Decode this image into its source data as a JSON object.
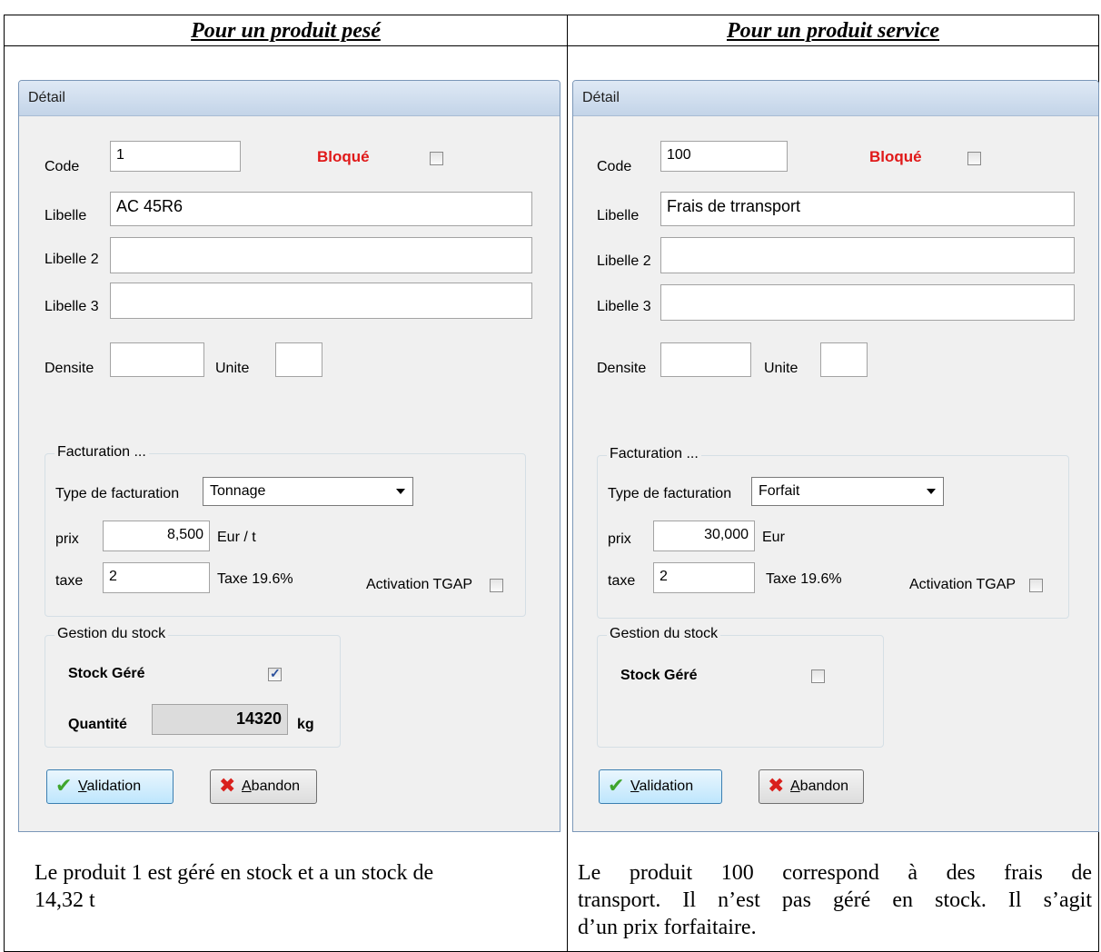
{
  "columns": {
    "left_header": "Pour un produit pesé",
    "right_header": "Pour un produit service"
  },
  "left": {
    "title": "Détail",
    "code_label": "Code",
    "code_value": "1",
    "bloque_label": "Bloqué",
    "libelle_label": "Libelle",
    "libelle_value": "AC 45R6",
    "libelle2_label": "Libelle 2",
    "libelle2_value": "",
    "libelle3_label": "Libelle 3",
    "libelle3_value": "",
    "densite_label": "Densite",
    "densite_value": "",
    "unite_label": "Unite",
    "unite_value": "",
    "facturation_legend": "Facturation ...",
    "type_label": "Type de facturation",
    "type_value": "Tonnage",
    "prix_label": "prix",
    "prix_value": "8,500",
    "prix_unit": "Eur / t",
    "taxe_label": "taxe",
    "taxe_value": "2",
    "taxe_rate": "Taxe 19.6%",
    "tgap_label": "Activation TGAP",
    "stock_legend": "Gestion du stock",
    "stock_gere_label": "Stock Géré",
    "stock_gere_checked": true,
    "quantite_label": "Quantité",
    "quantite_value": "14320",
    "quantite_unit": "kg",
    "validation_label": "Validation",
    "abandon_label": "Abandon"
  },
  "right": {
    "title": "Détail",
    "code_label": "Code",
    "code_value": "100",
    "bloque_label": "Bloqué",
    "libelle_label": "Libelle",
    "libelle_value": "Frais de trransport",
    "libelle2_label": "Libelle 2",
    "libelle2_value": "",
    "libelle3_label": "Libelle 3",
    "libelle3_value": "",
    "densite_label": "Densite",
    "densite_value": "",
    "unite_label": "Unite",
    "unite_value": "",
    "facturation_legend": "Facturation ...",
    "type_label": "Type de facturation",
    "type_value": "Forfait",
    "prix_label": "prix",
    "prix_value": "30,000",
    "prix_unit": "Eur",
    "taxe_label": "taxe",
    "taxe_value": "2",
    "taxe_rate": "Taxe 19.6%",
    "tgap_label": "Activation TGAP",
    "stock_legend": "Gestion du stock",
    "stock_gere_label": "Stock Géré",
    "stock_gere_checked": false,
    "validation_label": "Validation",
    "abandon_label": "Abandon"
  },
  "captions": {
    "left_line1": "Le produit 1 est géré en stock et a un stock  de",
    "left_line2": "14,32 t",
    "right_line1": "Le produit 100 correspond à des frais de",
    "right_line2": "transport. Il n’est pas géré en stock. Il s’agit",
    "right_line3": "d’un prix forfaitaire."
  },
  "colors": {
    "bloque": "#e01919",
    "validation_check": "#3fa52c",
    "abandon_x": "#d9201c"
  }
}
